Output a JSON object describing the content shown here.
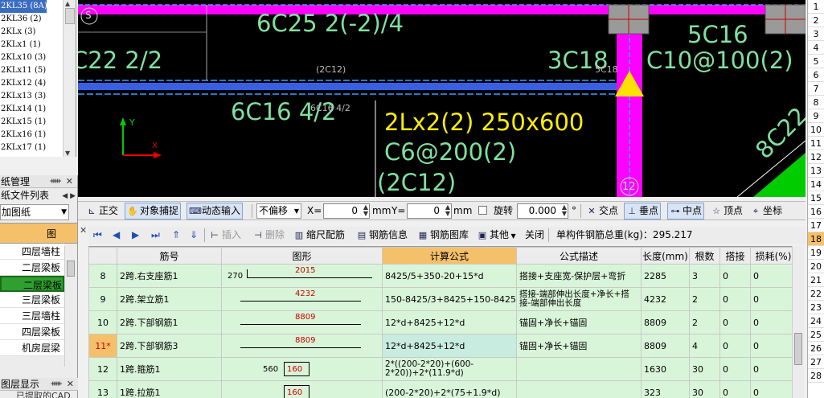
{
  "left_list": {
    "items": [
      "2KL35 (8A)",
      "2KL36 (2)",
      "2KLx (3)",
      "2KLx1 (1)",
      "2KLx10 (3)",
      "2KLx11 (5)",
      "2KLx12 (4)",
      "2KLx13 (3)",
      "2KLx14 (1)",
      "2KLx15 (1)",
      "2KLx16 (1)",
      "2KLx17 (1)"
    ],
    "selected_index": 0
  },
  "drawing_mgmt": {
    "title": "纸管理",
    "tab": "纸文件列表",
    "combo": "加图纸",
    "column_header": "图",
    "rows": [
      "四层墙柱",
      "二层梁板",
      "二层梁板",
      "三层梁板",
      "三层墙柱",
      "四层梁板",
      "机房层梁"
    ],
    "selected_row": 2
  },
  "layer_pane": {
    "title": "图层显示",
    "item": "已提取的CAD"
  },
  "canvas": {
    "labels": {
      "top_rebar": "6C25 2(-2)/4",
      "left_rebar": "C22 2/2",
      "mid_small": "(2C12)",
      "col_rebar": "3C18",
      "col_small": "5C18",
      "right_top": "5C16",
      "right_stirrup": "C10@100(2)",
      "bottom_rebar": "6C16 4/2",
      "bottom_small": "6C16 4/2",
      "beam_name": "2Lx2(2) 250x600",
      "beam_stirrup": "C6@200(2)",
      "beam_waist": "(2C12)",
      "diag": "8C22",
      "axis_top": "S",
      "axis_bottom": "12",
      "axis_y": "Y"
    }
  },
  "row_numbers": {
    "items": [
      "1",
      "2",
      "3",
      "4",
      "5",
      "6",
      "7",
      "8",
      "9",
      "10",
      "11",
      "12",
      "13",
      "14",
      "15",
      "16",
      "17",
      "18",
      "19",
      "20",
      "21",
      "22",
      "23",
      "24",
      "25",
      "26",
      "27",
      "28"
    ],
    "selected": "18"
  },
  "toolbar1": {
    "ortho": "正交",
    "snap": "对象捕捉",
    "dyn_input": "动态输入",
    "offset_mode": "不偏移",
    "x_label": "X=",
    "x_value": "0",
    "unit": "mm",
    "y_label": "Y=",
    "y_value": "0",
    "rotate": "旋转",
    "rotate_value": "0.000",
    "degree": "°",
    "intersect": "交点",
    "perp": "垂点",
    "midpoint": "中点",
    "vertex": "顶点",
    "coord": "坐标"
  },
  "toolbar2": {
    "insert": "插入",
    "delete": "删除",
    "scale_rebar": "缩尺配筋",
    "rebar_info": "钢筋信息",
    "rebar_lib": "钢筋图库",
    "other": "其他",
    "close": "关闭",
    "total_label": "单构件钢筋总重(kg)：295.217"
  },
  "table": {
    "headers": [
      "",
      "筋号",
      "图形",
      "计算公式",
      "公式描述",
      "长度(mm)",
      "根数",
      "搭接",
      "损耗(%)"
    ],
    "rows": [
      {
        "idx": "8",
        "name": "2跨.右支座筋1",
        "shape_left": "270",
        "shape_main": "2015",
        "formula": "8425/5+350-20+15*d",
        "desc": "搭接+支座宽-保护层+弯折",
        "length": "2285",
        "count": "3",
        "lap": "0",
        "loss": "0"
      },
      {
        "idx": "9",
        "name": "2跨.架立筋1",
        "shape_left": "",
        "shape_main": "4232",
        "formula": "150-8425/3+8425+150-8425/5",
        "desc": "搭接-端部伸出长度+净长+搭接-端部伸出长度",
        "length": "4232",
        "count": "2",
        "lap": "0",
        "loss": "0"
      },
      {
        "idx": "10",
        "name": "2跨.下部钢筋1",
        "shape_left": "",
        "shape_main": "8809",
        "formula": "12*d+8425+12*d",
        "desc": "锚固+净长+锚固",
        "length": "8809",
        "count": "2",
        "lap": "0",
        "loss": "0"
      },
      {
        "idx": "11*",
        "name": "2跨.下部钢筋3",
        "shape_left": "",
        "shape_main": "8809",
        "formula": "12*d+8425+12*d",
        "desc": "锚固+净长+锚固",
        "length": "8809",
        "count": "4",
        "lap": "0",
        "loss": "0"
      },
      {
        "idx": "12",
        "name": "1跨.箍筋1",
        "shape_left": "560",
        "shape_main": "160",
        "formula": "2*((200-2*20)+(600-2*20))+2*(11.9*d)",
        "desc": "",
        "length": "1630",
        "count": "30",
        "lap": "0",
        "loss": "0"
      },
      {
        "idx": "13",
        "name": "1跨.拉筋1",
        "shape_left": "",
        "shape_main": "160",
        "formula": "(200-2*20)+2*(75+1.9*d)",
        "desc": "",
        "length": "323",
        "count": "30",
        "lap": "0",
        "loss": "0"
      }
    ],
    "selected_idx": "11*"
  }
}
